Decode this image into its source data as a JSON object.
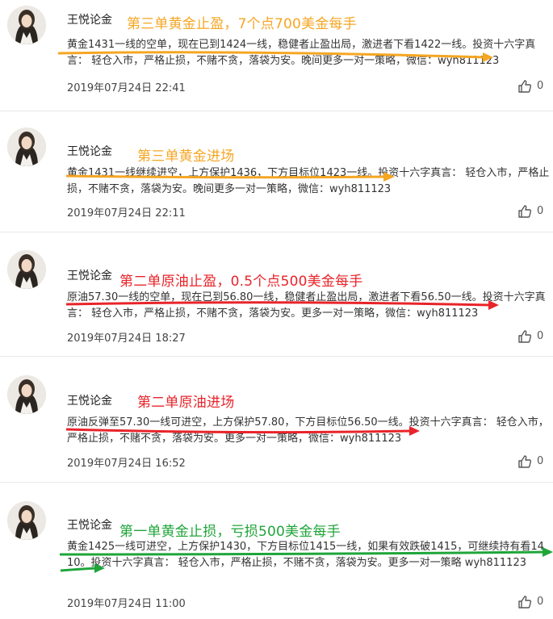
{
  "posts": [
    {
      "author": "王悦论金",
      "headline": "第三单黄金止盈，7个点700美金每手",
      "headline_color": "#f5a623",
      "content": "黄金1431一线的空单，现在已到1424一线，稳健者止盈出局，激进者下看1422一线。投资十六字真言： 轻仓入市，严格止损，不赌不贪，落袋为安。晚间更多一对一策略，微信：wyh811123",
      "time": "2019年07月24日 22:41",
      "likes": "0"
    },
    {
      "author": "王悦论金",
      "headline": "第三单黄金进场",
      "headline_color": "#f5a623",
      "content": "黄金1431一线继续进空，上方保护1436，下方目标位1423一线。投资十六字真言： 轻仓入市，严格止损，不赌不贪，落袋为安。晚间更多一对一策略，微信：wyh811123",
      "time": "2019年07月24日 22:11",
      "likes": "0"
    },
    {
      "author": "王悦论金",
      "headline": "第二单原油止盈，0.5个点500美金每手",
      "headline_color": "#e8242a",
      "content": "原油57.30一线的空单，现在已到56.80一线，稳健者止盈出局，激进者下看56.50一线。投资十六字真言： 轻仓入市，严格止损，不赌不贪，落袋为安。更多一对一策略，微信：wyh811123",
      "time": "2019年07月24日 18:27",
      "likes": "0"
    },
    {
      "author": "王悦论金",
      "headline": "第二单原油进场",
      "headline_color": "#e8242a",
      "content": "原油反弹至57.30一线可进空，上方保护57.80，下方目标位56.50一线。投资十六字真言： 轻仓入市，严格止损，不赌不贪，落袋为安。更多一对一策略，微信：wyh811123",
      "time": "2019年07月24日 16:52",
      "likes": "0"
    },
    {
      "author": "王悦论金",
      "headline": "第一单黄金止损，亏损500美金每手",
      "headline_color": "#1fa53a",
      "content": "黄金1425一线可进空，上方保护1430，下方目标位1415一线，如果有效跌破1415，可继续持有看1410。投资十六字真言： 轻仓入市，严格止损，不赌不贪，落袋为安。更多一对一策略 wyh811123",
      "time": "2019年07月24日 11:00",
      "likes": "0"
    }
  ],
  "icons": {
    "like": "thumbs-up-icon",
    "avatar": "user-avatar"
  }
}
